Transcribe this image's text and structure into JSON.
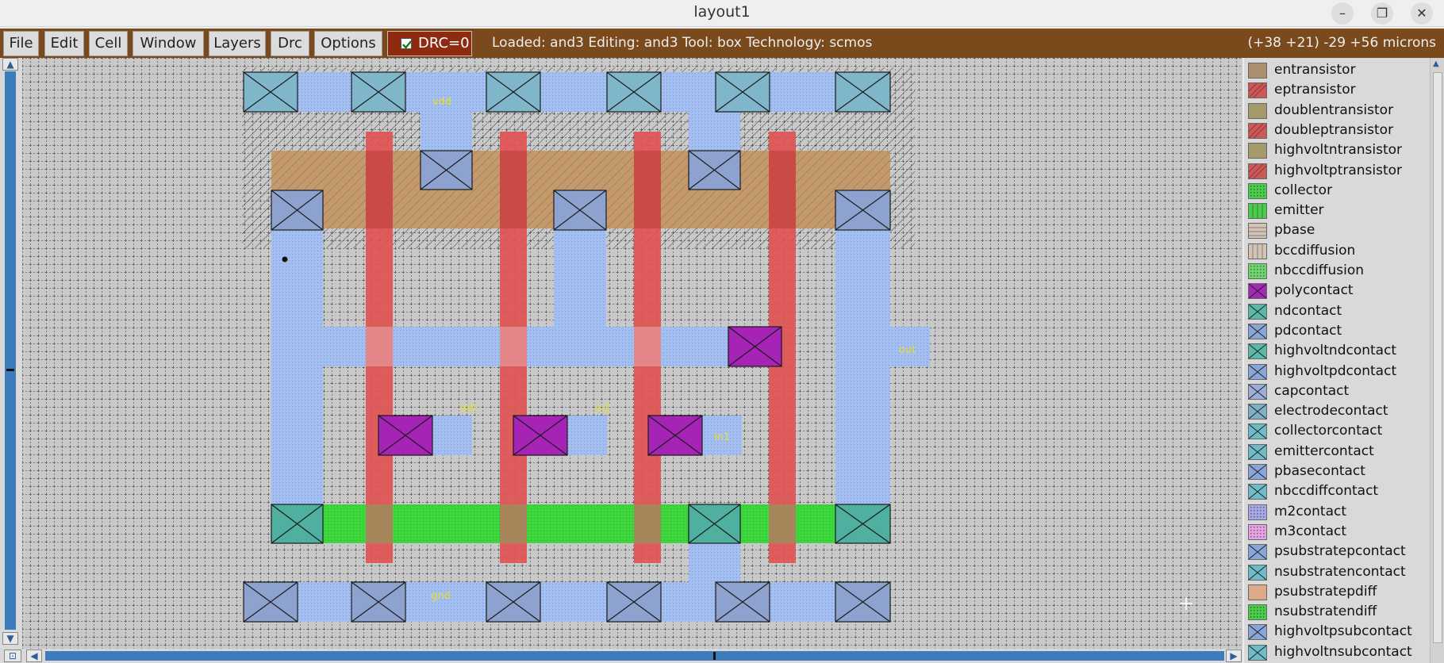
{
  "window": {
    "title": "layout1"
  },
  "window_controls": {
    "minimize": "–",
    "maximize": "❐",
    "close": "✕"
  },
  "menu": {
    "items": [
      "File",
      "Edit",
      "Cell",
      "Window",
      "Layers",
      "Drc",
      "Options"
    ]
  },
  "drc": {
    "label": "DRC=0",
    "checked": true
  },
  "status": {
    "text": "Loaded: and3 Editing: and3 Tool: box  Technology: scmos"
  },
  "coords": {
    "text": "(+38 +21) -29 +56 microns"
  },
  "canvas": {
    "labels": {
      "vdd": "vdd",
      "gnd": "gnd",
      "out": "out",
      "in0": "in0",
      "in2": "in2",
      "in1": "in1"
    }
  },
  "layers": [
    {
      "name": "entransistor",
      "color": "#a98f6e",
      "pattern": "solid"
    },
    {
      "name": "eptransistor",
      "color": "#cd5858",
      "pattern": "diag"
    },
    {
      "name": "doublentransistor",
      "color": "#a59a6a",
      "pattern": "solid"
    },
    {
      "name": "doubleptransistor",
      "color": "#cd5858",
      "pattern": "diag"
    },
    {
      "name": "highvoltntransistor",
      "color": "#a59a6a",
      "pattern": "solid"
    },
    {
      "name": "highvoltptransistor",
      "color": "#cd5858",
      "pattern": "diag"
    },
    {
      "name": "collector",
      "color": "#4ccc4c",
      "pattern": "dots"
    },
    {
      "name": "emitter",
      "color": "#4ccc4c",
      "pattern": "vstripe"
    },
    {
      "name": "pbase",
      "color": "#d2c3b5",
      "pattern": "hstripe"
    },
    {
      "name": "bccdiffusion",
      "color": "#d2c3b5",
      "pattern": "vstripe"
    },
    {
      "name": "nbccdiffusion",
      "color": "#6fd46f",
      "pattern": "dots"
    },
    {
      "name": "polycontact",
      "color": "#a22ab5",
      "pattern": "cross"
    },
    {
      "name": "ndcontact",
      "color": "#5ab9a8",
      "pattern": "cross"
    },
    {
      "name": "pdcontact",
      "color": "#8aa6d8",
      "pattern": "cross"
    },
    {
      "name": "highvoltndcontact",
      "color": "#5ab9a8",
      "pattern": "cross"
    },
    {
      "name": "highvoltpdcontact",
      "color": "#8aa6d8",
      "pattern": "cross"
    },
    {
      "name": "capcontact",
      "color": "#9aaed8",
      "pattern": "cross"
    },
    {
      "name": "electrodecontact",
      "color": "#7fb0c8",
      "pattern": "cross"
    },
    {
      "name": "collectorcontact",
      "color": "#6fbcc8",
      "pattern": "cross"
    },
    {
      "name": "emittercontact",
      "color": "#6fbcc8",
      "pattern": "cross"
    },
    {
      "name": "pbasecontact",
      "color": "#8aa6d8",
      "pattern": "cross"
    },
    {
      "name": "nbccdiffcontact",
      "color": "#6fbcc8",
      "pattern": "cross"
    },
    {
      "name": "m2contact",
      "color": "#a8a8e8",
      "pattern": "dots"
    },
    {
      "name": "m3contact",
      "color": "#e3a3e3",
      "pattern": "dots"
    },
    {
      "name": "psubstratepcontact",
      "color": "#8aa6d8",
      "pattern": "cross"
    },
    {
      "name": "nsubstratencontact",
      "color": "#6fbcc8",
      "pattern": "cross"
    },
    {
      "name": "psubstratepdiff",
      "color": "#dcaa88",
      "pattern": "solid"
    },
    {
      "name": "nsubstratendiff",
      "color": "#4ccc4c",
      "pattern": "dots"
    },
    {
      "name": "highvoltpsubcontact",
      "color": "#8aa6d8",
      "pattern": "cross"
    },
    {
      "name": "highvoltnsubcontact",
      "color": "#6fbcc8",
      "pattern": "cross"
    }
  ]
}
